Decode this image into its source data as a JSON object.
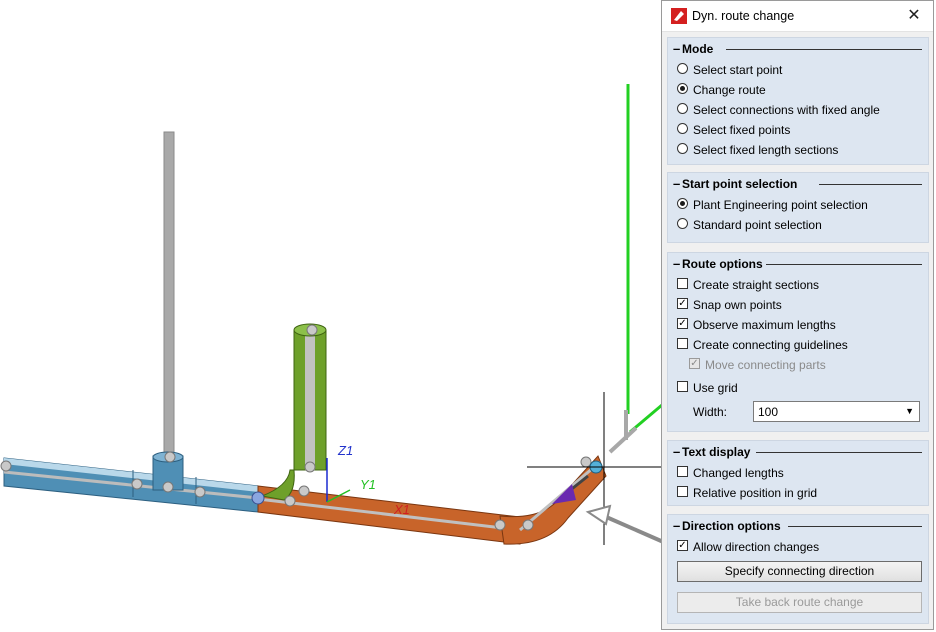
{
  "dialog": {
    "title": "Dyn. route change",
    "icon": "app-logo-icon",
    "close_icon": "close-icon"
  },
  "mode": {
    "title": "Mode",
    "options": [
      {
        "label": "Select start point",
        "checked": false
      },
      {
        "label": "Change route",
        "checked": true
      },
      {
        "label": "Select connections with fixed angle",
        "checked": false
      },
      {
        "label": "Select fixed points",
        "checked": false
      },
      {
        "label": "Select fixed length sections",
        "checked": false
      }
    ]
  },
  "start_point": {
    "title": "Start point selection",
    "options": [
      {
        "label": "Plant Engineering point selection",
        "checked": true
      },
      {
        "label": "Standard point selection",
        "checked": false
      }
    ]
  },
  "route_options": {
    "title": "Route options",
    "items": [
      {
        "label": "Create straight sections",
        "checked": false
      },
      {
        "label": "Snap own points",
        "checked": true
      },
      {
        "label": "Observe maximum lengths",
        "checked": true
      },
      {
        "label": "Create connecting guidelines",
        "checked": false
      },
      {
        "label": "Move connecting parts",
        "checked": true,
        "disabled": true
      },
      {
        "label": "Use grid",
        "checked": false
      }
    ],
    "width_label": "Width:",
    "width_value": "100"
  },
  "text_display": {
    "title": "Text display",
    "items": [
      {
        "label": "Changed lengths",
        "checked": false
      },
      {
        "label": "Relative position in grid",
        "checked": false
      }
    ]
  },
  "direction": {
    "title": "Direction options",
    "allow_label": "Allow direction changes",
    "allow_checked": true,
    "specify_button": "Specify connecting direction",
    "takeback_button": "Take back route change"
  },
  "viewport": {
    "axis_labels": {
      "z": "Z1",
      "y": "Y1",
      "x": "X1"
    },
    "colors": {
      "blue_pipe": "#4f8fb5",
      "orange_pipe": "#c8642a",
      "green_pipe": "#6ea02a",
      "guide": "#22d022"
    }
  }
}
